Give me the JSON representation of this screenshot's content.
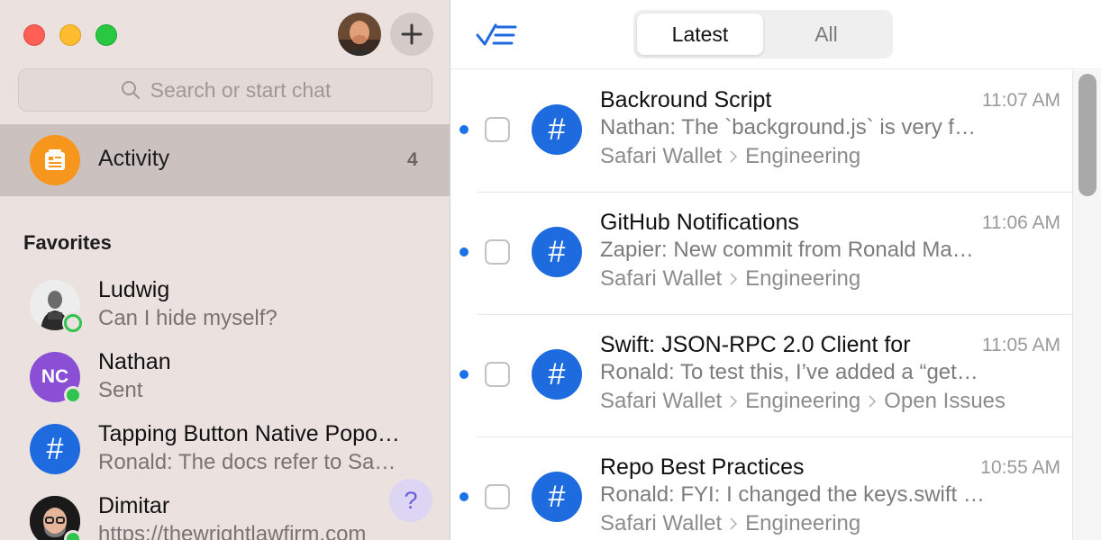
{
  "sidebar": {
    "search_placeholder": "Search or start chat",
    "activity": {
      "label": "Activity",
      "count": "4"
    },
    "favorites_header": "Favorites",
    "contacts": [
      {
        "name": "Ludwig",
        "sub": "Can I hide myself?",
        "presence": "outline"
      },
      {
        "name": "Nathan",
        "sub": "Sent",
        "initials": "NC",
        "presence": "online"
      },
      {
        "name": "Tapping Button Native Popo…",
        "sub": "Ronald: The docs refer to Sa…"
      },
      {
        "name": "Dimitar",
        "sub": "https://thewrightlawfirm.com",
        "presence": "online"
      }
    ],
    "help_label": "?"
  },
  "toolbar": {
    "tabs": [
      "Latest",
      "All"
    ],
    "active_tab": "Latest"
  },
  "threads": [
    {
      "title": "Backround Script",
      "time": "11:07 AM",
      "preview": "Nathan: The `background.js` is very f…",
      "crumbs": [
        "Safari Wallet",
        "Engineering"
      ]
    },
    {
      "title": "GitHub Notifications",
      "time": "11:06 AM",
      "preview": "Zapier: New commit from Ronald Ma…",
      "crumbs": [
        "Safari Wallet",
        "Engineering"
      ]
    },
    {
      "title": "Swift: JSON-RPC 2.0 Client for",
      "time": "11:05 AM",
      "preview": "Ronald: To test this, I’ve added a “get…",
      "crumbs": [
        "Safari Wallet",
        "Engineering",
        "Open Issues"
      ]
    },
    {
      "title": "Repo Best Practices",
      "time": "10:55 AM",
      "preview": "Ronald: FYI: I changed the keys.swift …",
      "crumbs": [
        "Safari Wallet",
        "Engineering"
      ]
    }
  ],
  "colors": {
    "accent": "#1d6bdf",
    "unread_dot": "#1a73e8",
    "activity_orange": "#f7961c",
    "online_green": "#2fc44d",
    "sidebar_bg": "#ebe2e0"
  }
}
